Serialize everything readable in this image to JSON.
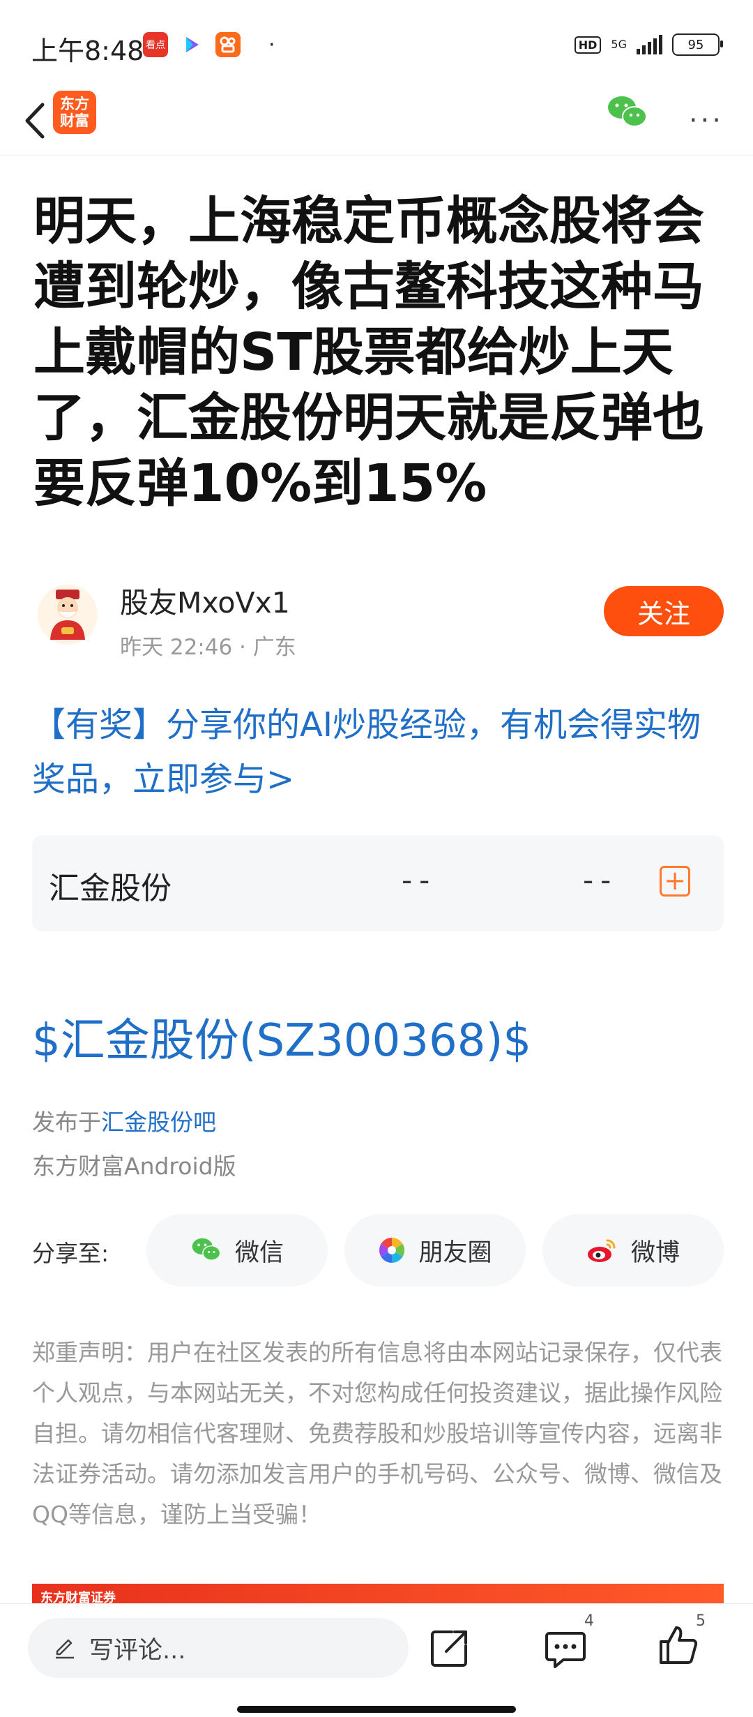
{
  "status_bar": {
    "time": "上午8:48",
    "apps": [
      {
        "icon": "toutiao-app-icon",
        "label": "看点",
        "color": "#e8352a"
      },
      {
        "icon": "video-app-icon",
        "label": "",
        "color": "#7b5cff"
      },
      {
        "icon": "kuaishou-app-icon",
        "label": "",
        "color": "#ff6a1a"
      }
    ],
    "dot": "·",
    "hd": "HD",
    "network": "5G",
    "battery": "95"
  },
  "nav": {
    "back_glyph": "‹",
    "logo_line1": "东方",
    "logo_line2": "财富",
    "more_glyph": "···"
  },
  "post": {
    "title": "明天，上海稳定币概念股将会遭到轮炒，像古鳌科技这种马上戴帽的ST股票都给炒上天了，汇金股份明天就是反弹也要反弹10%到15%",
    "author_name": "股友MxoVx1",
    "author_meta": "昨天 22:46 · 广东",
    "follow_label": "关注",
    "promo": "【有奖】分享你的AI炒股经验，有机会得实物奖品，立即参与>"
  },
  "stock_card": {
    "name": "汇金股份",
    "price": "--",
    "change": "--",
    "add_glyph": "+"
  },
  "stock_tag": "$汇金股份(SZ300368)$",
  "meta": {
    "posted_prefix": "发布于",
    "posted_bar": "汇金股份吧",
    "client": "东方财富Android版"
  },
  "share": {
    "label": "分享至:",
    "buttons": [
      {
        "label": "微信",
        "icon": "wechat-icon"
      },
      {
        "label": "朋友圈",
        "icon": "moments-icon"
      },
      {
        "label": "微博",
        "icon": "weibo-icon"
      }
    ]
  },
  "disclaimer": "郑重声明：用户在社区发表的所有信息将由本网站记录保存，仅代表个人观点，与本网站无关，不对您构成任何投资建议，据此操作风险自担。请勿相信代客理财、免费荐股和炒股培训等宣传内容，远离非法证券活动。请勿添加发言用户的手机号码、公众号、微博、微信及QQ等信息，谨防上当受骗！",
  "banner": {
    "text": "东方财富证券"
  },
  "bottom": {
    "comment_placeholder": "写评论...",
    "comment_count": "4",
    "like_count": "5"
  }
}
